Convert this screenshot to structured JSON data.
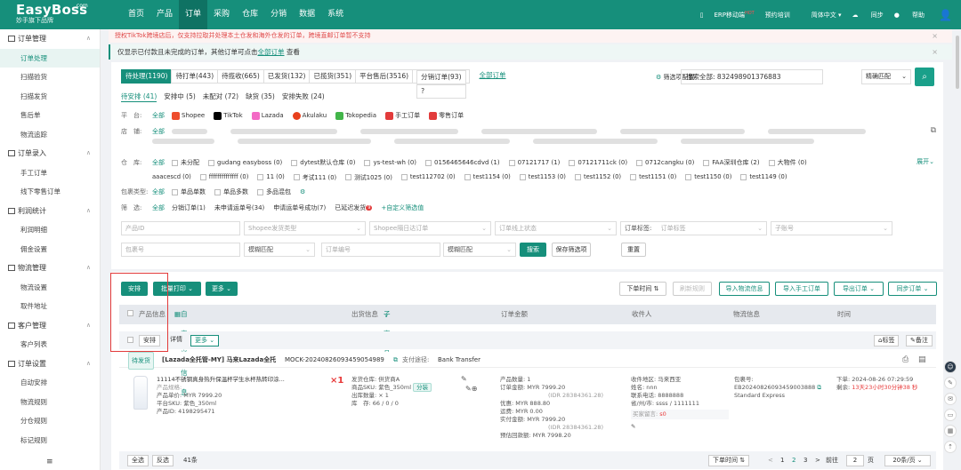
{
  "topbar": {
    "logo": "EasyBoss",
    "logo_com": ".com",
    "logo_sub": "妙手旗下品牌",
    "nav": [
      "首页",
      "产品",
      "订单",
      "采购",
      "仓库",
      "分销",
      "数据",
      "系统"
    ],
    "active_nav": 2,
    "right": {
      "erp": "ERP移动端",
      "hot": "HOT",
      "training": "预约培训",
      "lang": "简体中文",
      "sync": "同步",
      "help": "帮助"
    }
  },
  "sidebar": [
    {
      "group": "订单管理",
      "items": [
        "订单处理",
        "扫描验货",
        "扫描发货",
        "售后单",
        "物流追踪"
      ]
    },
    {
      "group": "订单录入",
      "items": [
        "手工订单",
        "线下零售订单"
      ]
    },
    {
      "group": "利润统计",
      "items": [
        "利润明细",
        "佣金设置"
      ]
    },
    {
      "group": "物流管理",
      "items": [
        "物流设置",
        "取件地址"
      ]
    },
    {
      "group": "客户管理",
      "items": [
        "客户列表"
      ]
    },
    {
      "group": "订单设置",
      "items": [
        "自动安排",
        "物流规则",
        "分仓规则",
        "标记规则"
      ]
    }
  ],
  "notice1": "授权TikTok跨境店后，仅支持拉取并处理本土仓发和海外仓发的订单，跨境直邮订单暂不支持",
  "notice2": {
    "text": "仅显示已付款且未完成的订单，其他订单可点击",
    "link": "全部订单",
    "tail": "查看"
  },
  "status_tabs": [
    "待处理(1190)",
    "待打单(443)",
    "待揽收(665)",
    "已发货(132)",
    "已揽货(351)",
    "平台售后(3516)",
    "分销订单(93)"
  ],
  "all_orders_link": "全部订单",
  "filter_config": "筛选项配置",
  "search": {
    "label": "搜索全部:",
    "value": "832498901376883",
    "mode": "精确匹配"
  },
  "sub_tabs": [
    "待安排 (41)",
    "安排中 (5)",
    "未配对 (72)",
    "缺货 (35)",
    "安排失败 (24)"
  ],
  "platform": {
    "label": "平　台:",
    "all": "全部",
    "items": [
      "Shopee",
      "TikTok",
      "Lazada",
      "Akulaku",
      "Tokopedia",
      "手工订单",
      "零售订单"
    ],
    "colors": [
      "#ee4d2d",
      "#000000",
      "#f36ac5",
      "#e8401c",
      "#42b549",
      "#e23b3b",
      "#e23b3b"
    ]
  },
  "shop": {
    "label": "店　铺:",
    "all": "全部"
  },
  "warehouse": {
    "label": "仓　库:",
    "all": "全部",
    "row1": [
      "未分配",
      "gudang easyboss (0)",
      "dytest默认仓库 (0)",
      "ys-test-wh (0)",
      "0156465646cdvd (1)",
      "07121717 (1)",
      "07121711ck (0)",
      "0712cangku (0)",
      "FAA深圳仓库 (2)",
      "大物件 (0)"
    ],
    "row2": [
      "aaacescd (0)",
      "ffffffffffffff (0)",
      "11 (0)",
      "考试111 (0)",
      "测试1025 (0)",
      "test112702 (0)",
      "test1154 (0)",
      "test1153 (0)",
      "test1152 (0)",
      "test1151 (0)",
      "test1150 (0)",
      "test1149 (0)"
    ],
    "expand": "展开"
  },
  "package": {
    "label": "包裹类型:",
    "all": "全部",
    "items": [
      "单品单数",
      "单品多数",
      "多品混包"
    ]
  },
  "screen": {
    "label": "筛　选:",
    "all": "全部",
    "items": [
      "分销订单(1)",
      "未申请运单号(34)",
      "申请运单号成功(7)",
      "已延迟发货"
    ],
    "badge": "9",
    "custom": "+自定义筛选值"
  },
  "inputs": {
    "product_id": "产品ID",
    "shopee_type": "Shopee发货类型",
    "shopee_sep": "Shopee隔日达订单",
    "online_status": "订单线上状态",
    "order_tag": "订单标签:",
    "order_tag_ph": "订单标签",
    "sub_order": "子账号",
    "package_no": "包裹号",
    "fuzzy": "模糊匹配",
    "order_no": "订单编号",
    "fuzzy2": "模糊匹配",
    "search_btn": "搜索",
    "save_filter": "保存筛选项",
    "reset": "重置"
  },
  "toolbar": {
    "arrange": "安排",
    "batch_print": "批量打印",
    "more": "更多",
    "order_time": "下单时间",
    "refresh": "刷新规则",
    "import_logistics": "导入物流信息",
    "import_manual": "导入手工订单",
    "export": "导出订单",
    "sync_order": "同步订单"
  },
  "table_head": {
    "product": "产品信息",
    "custom": "自定义信息",
    "outbound": "出货信息",
    "sub_goods": "子商品",
    "amount": "订单金额",
    "receiver": "收件人",
    "logistics": "物流信息",
    "time": "时间"
  },
  "subbar": {
    "arrange": "安排",
    "detail": "详情",
    "more": "更多",
    "tag": "标签",
    "note": "备注"
  },
  "order": {
    "status": "待发货",
    "shop": "[Lazada全托管-MY] 马来Lazada全托",
    "mock": "MOCK-20240826093459054989",
    "pay_label": "支付途径:",
    "pay": "Bank Transfer",
    "product_name": "11114不锈钢真身热升保温杯学生水杯热转印涂...",
    "qty_mark": "×1",
    "spec": "产品规格:",
    "price": "产品单价:  MYR 7999.20",
    "sku": "平台SKU:  紫色_350ml",
    "pid": "产品ID:   4198295471",
    "ship": [
      "发货仓库:  供货商A",
      "商品SKU:  紫色_350ml",
      "出库数量:  ×  1",
      "库　存:  66 / 0 / 0"
    ],
    "split": "分装",
    "amount": [
      "产品数量: 1",
      "订单金额:  MYR 7999.20",
      "(IDR 28384361.28)",
      "优惠:  MYR 888.80",
      "运费:  MYR 0.00",
      "实付金额:  MYR 7999.20",
      "(IDR 28384361.28)",
      "预估回款额:  MYR 7998.20"
    ],
    "receiver": [
      "收件地区:  马来西亚",
      "姓名:  nnn",
      "联系电话:  8888888",
      "省/州/市: ssss / 1111111"
    ],
    "buyer_note_label": "买家留言:",
    "buyer_note": "s0",
    "logistics": [
      "包裹号:",
      "EB20240826093459003888",
      "Standard Express"
    ],
    "time1": "下单:  2024-08-26 07:29:59",
    "time2_label": "剩余:",
    "time2": "13天23小时30分钟38 秒"
  },
  "footer": {
    "select_all": "全选",
    "invert": "反选",
    "count": "41条",
    "order_time": "下单时间",
    "pages": [
      "1",
      "2",
      "3"
    ],
    "prev": "<",
    "next": ">",
    "goto": "前往",
    "page": "2",
    "page_unit": "页",
    "per_page": "20条/页"
  }
}
